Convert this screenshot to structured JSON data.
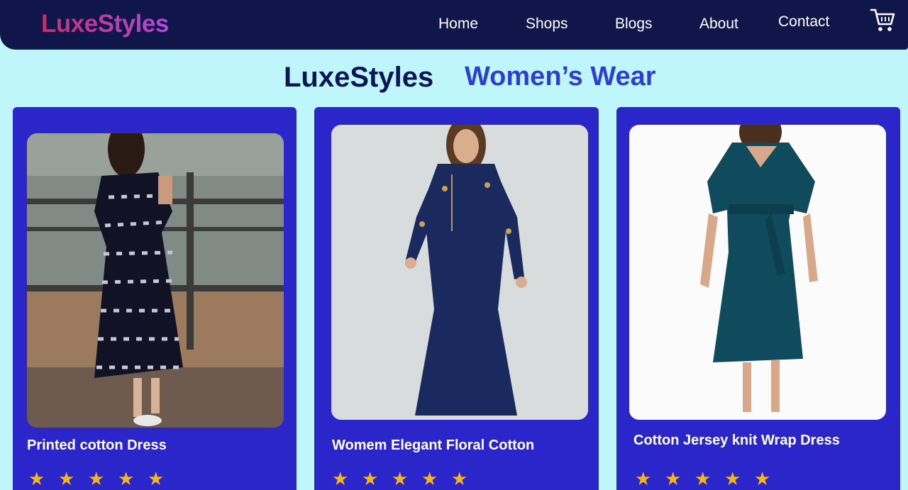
{
  "brand": {
    "logo": "LuxeStyles",
    "logo_gradient": [
      "#c2306a",
      "#b04bd8"
    ]
  },
  "nav": {
    "items": [
      {
        "label": "Home"
      },
      {
        "label": "Shops"
      },
      {
        "label": "Blogs"
      },
      {
        "label": "About"
      },
      {
        "label": "Contact"
      }
    ],
    "cart_icon": "shopping-cart-icon"
  },
  "heading": {
    "brand": "LuxeStyles",
    "subtitle": "Women’s Wear"
  },
  "products": [
    {
      "title": "Printed cotton Dress",
      "rating": 5,
      "image_icon": "dress-photo"
    },
    {
      "title": "Womem Elegant Floral Cotton",
      "rating": 5,
      "image_icon": "dress-photo"
    },
    {
      "title": "Cotton Jersey knit Wrap Dress",
      "rating": 5,
      "image_icon": "dress-photo"
    }
  ],
  "colors": {
    "nav_bg": "#11164a",
    "page_bg": "#bff6fb",
    "card_bg": "#2a26c9",
    "heading_dark": "#0d1655",
    "heading_accent": "#2e3fd0",
    "star": "#f7b51c"
  }
}
